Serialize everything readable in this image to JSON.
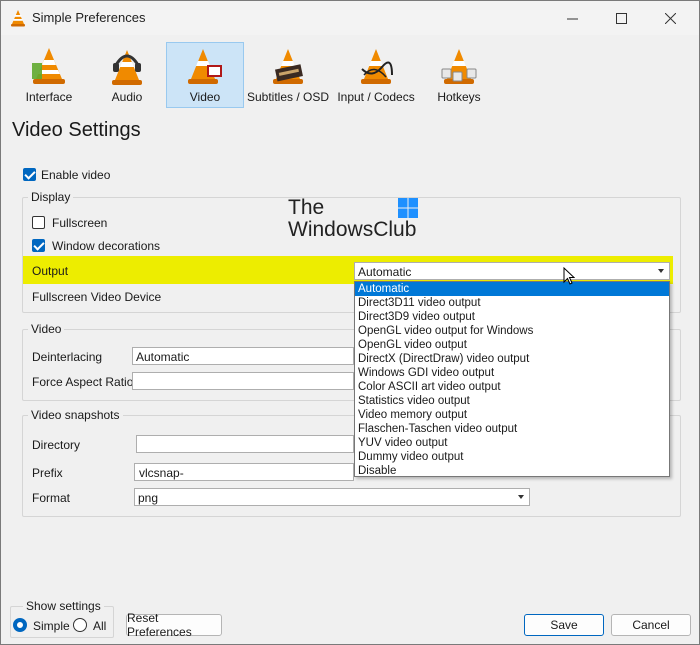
{
  "window": {
    "title": "Simple Preferences"
  },
  "toolbar": [
    {
      "label": "Interface",
      "icon": "cone-icon"
    },
    {
      "label": "Audio",
      "icon": "headphones-cone-icon"
    },
    {
      "label": "Video",
      "icon": "video-cone-icon"
    },
    {
      "label": "Subtitles / OSD",
      "icon": "subtitles-cone-icon"
    },
    {
      "label": "Input / Codecs",
      "icon": "codecs-cone-icon"
    },
    {
      "label": "Hotkeys",
      "icon": "hotkeys-cone-icon"
    }
  ],
  "page_title": "Video Settings",
  "enable_video": {
    "label": "Enable video",
    "checked": true
  },
  "display": {
    "title": "Display",
    "fullscreen": {
      "label": "Fullscreen",
      "checked": false
    },
    "window_decorations": {
      "label": "Window decorations",
      "checked": true
    },
    "output_label": "Output",
    "output_value": "Automatic",
    "fullscreen_device_label": "Fullscreen Video Device",
    "output_options": [
      "Automatic",
      "Direct3D11 video output",
      "Direct3D9 video output",
      "OpenGL video output for Windows",
      "OpenGL video output",
      "DirectX (DirectDraw) video output",
      "Windows GDI video output",
      "Color ASCII art video output",
      "Statistics video output",
      "Video memory output",
      "Flaschen-Taschen video output",
      "YUV video output",
      "Dummy video output",
      "Disable"
    ]
  },
  "video": {
    "title": "Video",
    "deinterlacing_label": "Deinterlacing",
    "deinterlacing_value": "Automatic",
    "aspect_label": "Force Aspect Ratio",
    "aspect_value": ""
  },
  "snapshots": {
    "title": "Video snapshots",
    "directory_label": "Directory",
    "directory_value": "",
    "prefix_label": "Prefix",
    "prefix_value": "vlcsnap-",
    "format_label": "Format",
    "format_value": "png"
  },
  "watermark": {
    "line1": "The",
    "line2": "WindowsClub"
  },
  "footer": {
    "show_settings": "Show settings",
    "simple": "Simple",
    "all": "All",
    "reset": "Reset Preferences",
    "save": "Save",
    "cancel": "Cancel"
  },
  "colors": {
    "accent": "#0067c0",
    "highlight": "#eded00",
    "vlc_orange": "#f08a00"
  }
}
